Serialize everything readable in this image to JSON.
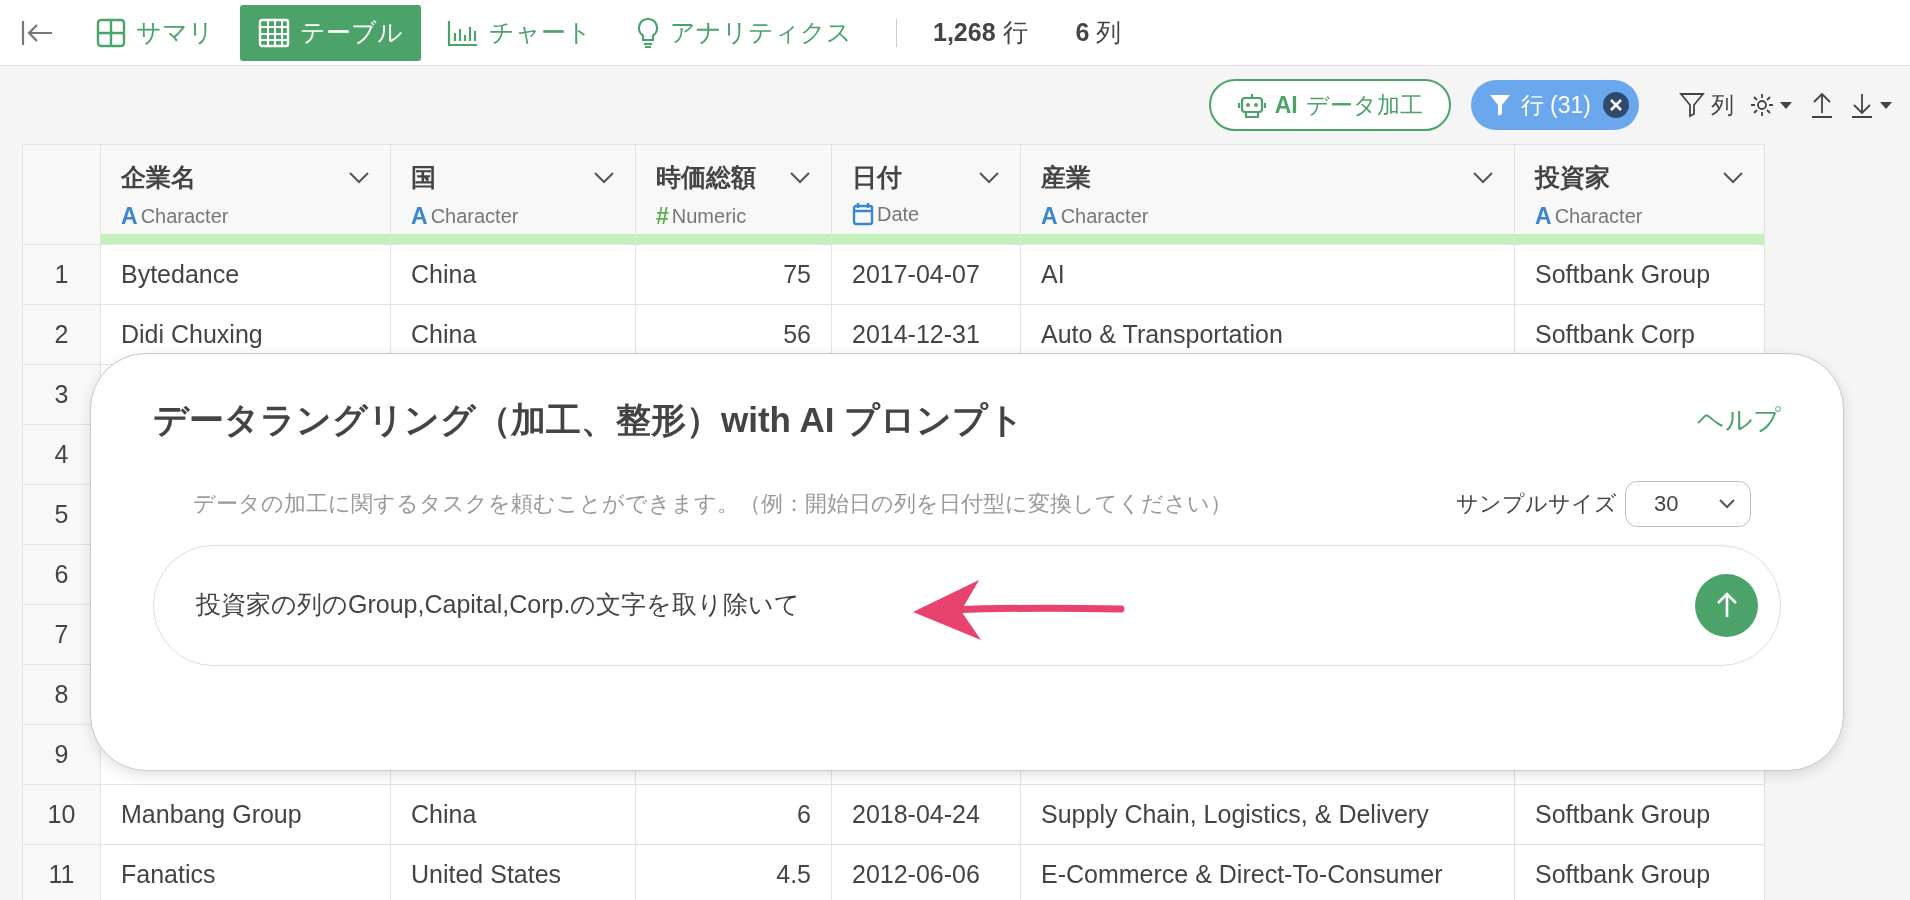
{
  "nav": {
    "tabs": [
      {
        "label": "サマリ",
        "selected": false
      },
      {
        "label": "テーブル",
        "selected": true
      },
      {
        "label": "チャート",
        "selected": false
      },
      {
        "label": "アナリティクス",
        "selected": false
      }
    ],
    "stats": [
      {
        "value": "1,268",
        "unit": "行"
      },
      {
        "value": "6",
        "unit": "列"
      }
    ]
  },
  "toolbar": {
    "ai_button": {
      "strong": "AI",
      "label": "データ加工"
    },
    "filter_chip": {
      "label": "行 (31)"
    },
    "column_button": {
      "label": "列"
    }
  },
  "table": {
    "columns": [
      {
        "name": "企業名",
        "type": "Character",
        "kind": "text",
        "type_mark": "A"
      },
      {
        "name": "国",
        "type": "Character",
        "kind": "text",
        "type_mark": "A"
      },
      {
        "name": "時価総額",
        "type": "Numeric",
        "kind": "number",
        "type_mark": "#"
      },
      {
        "name": "日付",
        "type": "Date",
        "kind": "date"
      },
      {
        "name": "産業",
        "type": "Character",
        "kind": "text",
        "type_mark": "A"
      },
      {
        "name": "投資家",
        "type": "Character",
        "kind": "text",
        "type_mark": "A"
      }
    ],
    "rows": [
      {
        "number": "1",
        "cells": [
          "Bytedance",
          "China",
          "75",
          "2017-04-07",
          "AI",
          "Softbank Group"
        ]
      },
      {
        "number": "2",
        "cells": [
          "Didi Chuxing",
          "China",
          "56",
          "2014-12-31",
          "Auto & Transportation",
          "Softbank Corp"
        ]
      },
      {
        "number": "3",
        "cells": []
      },
      {
        "number": "4",
        "cells": []
      },
      {
        "number": "5",
        "cells": []
      },
      {
        "number": "6",
        "cells": []
      },
      {
        "number": "7",
        "cells": []
      },
      {
        "number": "8",
        "cells": []
      },
      {
        "number": "9",
        "cells": []
      },
      {
        "number": "10",
        "cells": [
          "Manbang Group",
          "China",
          "6",
          "2018-04-24",
          "Supply Chain, Logistics, & Delivery",
          "Softbank Group"
        ]
      },
      {
        "number": "11",
        "cells": [
          "Fanatics",
          "United States",
          "4.5",
          "2012-06-06",
          "E-Commerce & Direct-To-Consumer",
          "Softbank Group"
        ]
      }
    ]
  },
  "dialog": {
    "title": "データラングリング（加工、整形）with AI プロンプト",
    "help_link": "ヘルプ",
    "hint": "データの加工に関するタスクを頼むことができます。（例：開始日の列を日付型に変換してください）",
    "sample_size": {
      "label": "サンプルサイズ",
      "value": "30"
    },
    "prompt": {
      "value": "投資家の列のGroup,Capital,Corp.の文字を取り除いて"
    }
  }
}
